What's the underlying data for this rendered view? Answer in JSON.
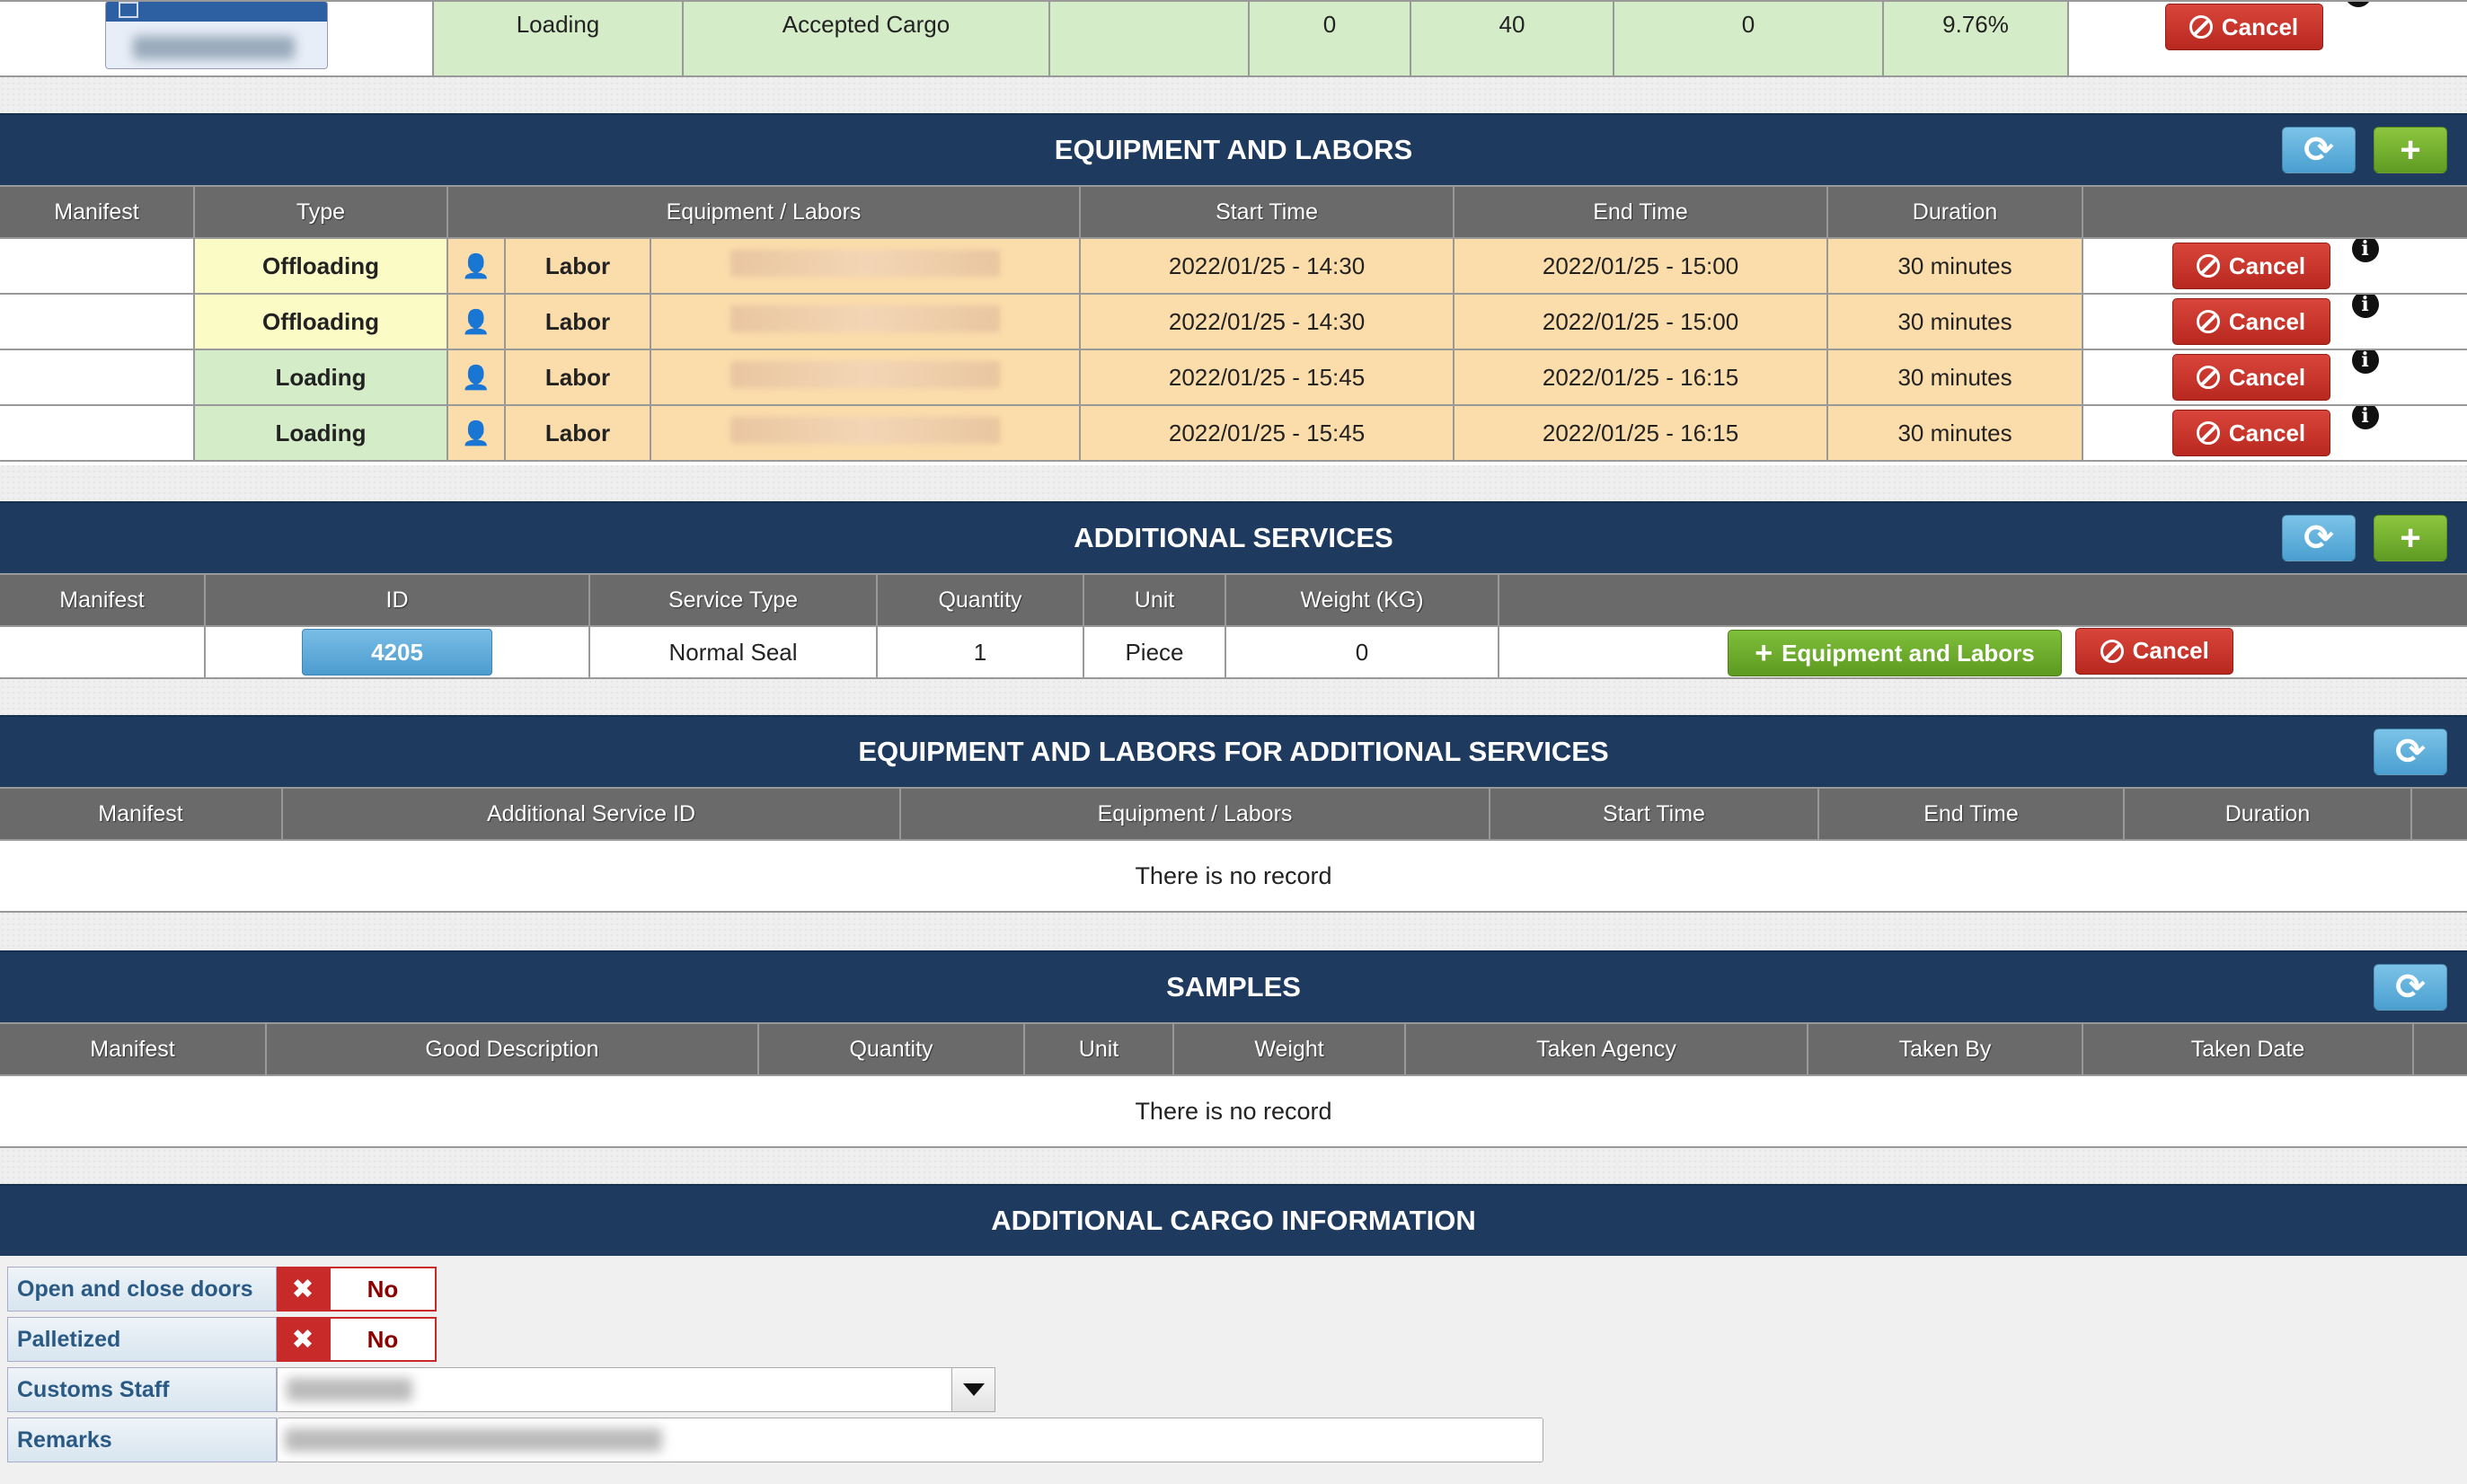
{
  "top_row": {
    "type": "Loading",
    "status": "Accepted Cargo",
    "col3": "",
    "val1": "0",
    "val2": "40",
    "val3": "0",
    "percent": "9.76%",
    "cancel_label": "Cancel"
  },
  "equipment": {
    "title": "EQUIPMENT AND LABORS",
    "headers": [
      "Manifest",
      "Type",
      "Equipment / Labors",
      "Start Time",
      "End Time",
      "Duration",
      ""
    ],
    "rows": [
      {
        "type": "Offloading",
        "kind": "Labor",
        "start": "2022/01/25 - 14:30",
        "end": "2022/01/25 - 15:00",
        "duration": "30 minutes"
      },
      {
        "type": "Offloading",
        "kind": "Labor",
        "start": "2022/01/25 - 14:30",
        "end": "2022/01/25 - 15:00",
        "duration": "30 minutes"
      },
      {
        "type": "Loading",
        "kind": "Labor",
        "start": "2022/01/25 - 15:45",
        "end": "2022/01/25 - 16:15",
        "duration": "30 minutes"
      },
      {
        "type": "Loading",
        "kind": "Labor",
        "start": "2022/01/25 - 15:45",
        "end": "2022/01/25 - 16:15",
        "duration": "30 minutes"
      }
    ],
    "cancel_label": "Cancel"
  },
  "additional": {
    "title": "ADDITIONAL SERVICES",
    "headers": [
      "Manifest",
      "ID",
      "Service Type",
      "Quantity",
      "Unit",
      "Weight (KG)",
      ""
    ],
    "row": {
      "manifest": "",
      "id": "4205",
      "service_type": "Normal Seal",
      "quantity": "1",
      "unit": "Piece",
      "weight": "0"
    },
    "eq_label": "Equipment and Labors",
    "cancel_label": "Cancel"
  },
  "eq_additional": {
    "title": "EQUIPMENT AND LABORS FOR ADDITIONAL SERVICES",
    "headers": [
      "Manifest",
      "Additional Service ID",
      "Equipment / Labors",
      "Start Time",
      "End Time",
      "Duration",
      ""
    ],
    "empty": "There is no record"
  },
  "samples": {
    "title": "SAMPLES",
    "headers": [
      "Manifest",
      "Good Description",
      "Quantity",
      "Unit",
      "Weight",
      "Taken Agency",
      "Taken By",
      "Taken Date",
      ""
    ],
    "empty": "There is no record"
  },
  "cargo_info": {
    "title": "ADDITIONAL CARGO INFORMATION",
    "doors_label": "Open and close doors",
    "doors_value": "No",
    "palletized_label": "Palletized",
    "palletized_value": "No",
    "customs_label": "Customs Staff",
    "remarks_label": "Remarks"
  },
  "colors": {
    "header_bg": "#1e3a5f",
    "cancel_red": "#c0302a",
    "add_green": "#6aab2c",
    "refresh_blue": "#5aa9d9"
  }
}
